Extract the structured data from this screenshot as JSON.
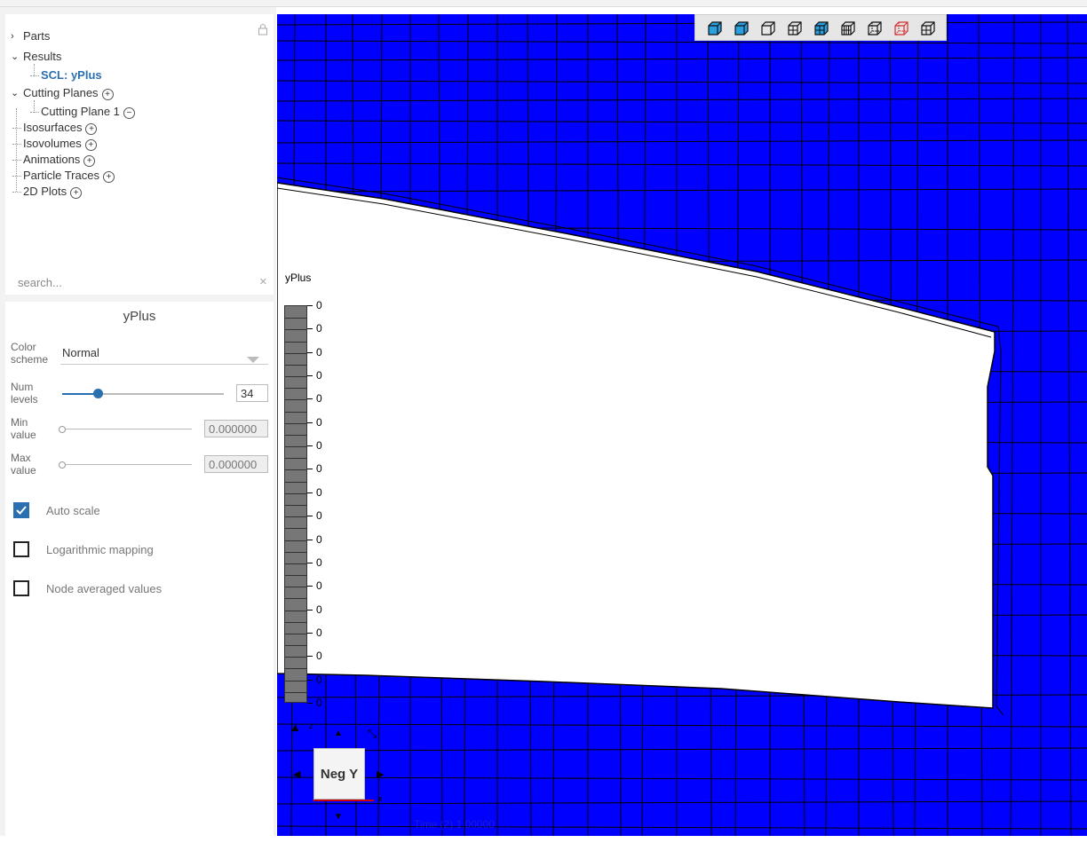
{
  "tree": {
    "items": [
      {
        "label": "Parts",
        "expander": "›",
        "plus": false,
        "selected": false
      },
      {
        "label": "Results",
        "expander": "⌄",
        "plus": false,
        "selected": false
      },
      {
        "label": "SCL: yPlus",
        "expander": "",
        "plus": false,
        "selected": true
      },
      {
        "label": "Cutting Planes",
        "expander": "⌄",
        "plus": true,
        "selected": false
      },
      {
        "label": "Cutting Plane 1",
        "expander": "",
        "minus": true,
        "selected": false
      },
      {
        "label": "Isosurfaces",
        "expander": "",
        "plus": true,
        "selected": false
      },
      {
        "label": "Isovolumes",
        "expander": "",
        "plus": true,
        "selected": false
      },
      {
        "label": "Animations",
        "expander": "",
        "plus": true,
        "selected": false
      },
      {
        "label": "Particle Traces",
        "expander": "",
        "plus": true,
        "selected": false
      },
      {
        "label": "2D Plots",
        "expander": "",
        "plus": true,
        "selected": false
      }
    ],
    "search_placeholder": "search...",
    "search_clear": "×",
    "lock_icon": "lock-icon"
  },
  "props": {
    "title": "yPlus",
    "color_scheme_label": "Color scheme",
    "color_scheme_value": "Normal",
    "num_levels_label": "Num levels",
    "num_levels_value": "34",
    "num_levels_fraction": 0.22,
    "min_label": "Min value",
    "min_value": "0.000000",
    "max_label": "Max value",
    "max_value": "0.000000",
    "checkboxes": [
      {
        "label": "Auto scale",
        "checked": true
      },
      {
        "label": "Logarithmic mapping",
        "checked": false
      },
      {
        "label": "Node averaged values",
        "checked": false
      }
    ]
  },
  "viewport": {
    "background_color": "#0000ff",
    "legend": {
      "title": "yPlus",
      "labels": [
        "0",
        "0",
        "0",
        "0",
        "0",
        "0",
        "0",
        "0",
        "0",
        "0",
        "0",
        "0",
        "0",
        "0",
        "0",
        "0",
        "0",
        "0"
      ],
      "bar_color": "#777777",
      "segments": 34
    },
    "toolbar_icons": [
      "solid-cube-icon",
      "shaded-cube-icon",
      "outline-cube-icon",
      "mesh-cube-icon",
      "solid-mesh-cube-icon",
      "dense-mesh-cube-icon",
      "wireframe-cube-icon",
      "red-wireframe-cube-icon",
      "grid-cube-icon"
    ],
    "orientation": {
      "view_label": "Neg Y",
      "axis_z": "z",
      "axis_x": "x"
    },
    "time_label": "Time (2) 1.00000"
  }
}
